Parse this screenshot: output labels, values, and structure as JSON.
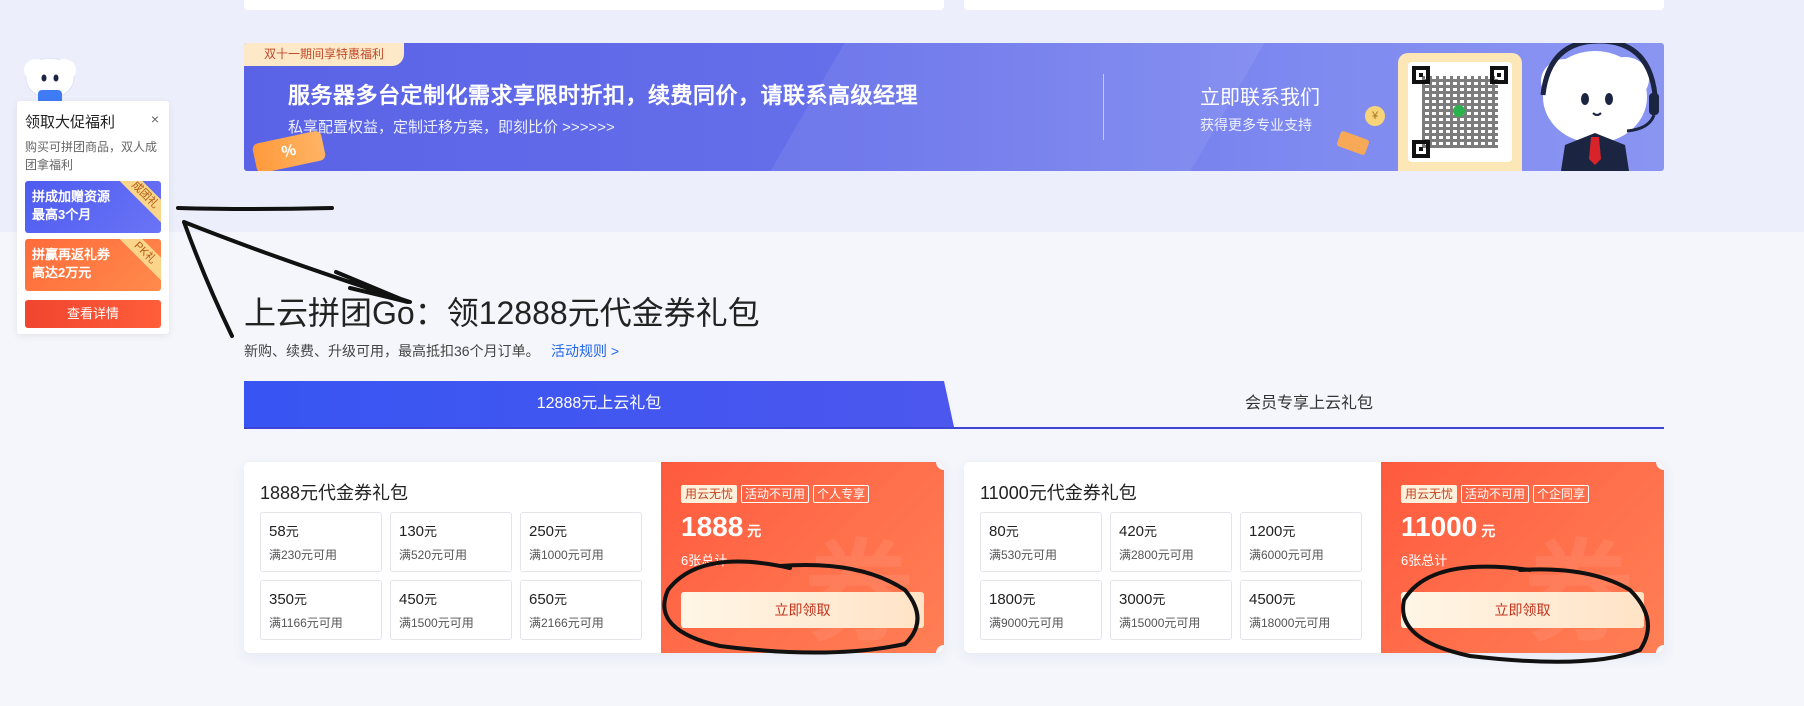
{
  "banner": {
    "tag": "双十一期间享特惠福利",
    "headline": "服务器多台定制化需求享限时折扣，续费同价，请联系高级经理",
    "sub": "私享配置权益，定制迁移方案，即刻比价 >>>>>>",
    "coupon_deco": "%",
    "coin": "¥",
    "contact_title": "立即联系我们",
    "contact_sub": "获得更多专业支持"
  },
  "float_widget": {
    "title": "领取大促福利",
    "close": "×",
    "desc": "购买可拼团商品，双人成团拿福利",
    "promo1": {
      "line1": "拼成加赠资源",
      "line2": "最高3个月",
      "ribbon": "成团礼"
    },
    "promo2": {
      "line1": "拼赢再返礼券",
      "line2": "高达2万元",
      "ribbon": "PK礼"
    },
    "detail_button": "查看详情"
  },
  "section": {
    "title": "上云拼团Go：领12888元代金券礼包",
    "desc": "新购、续费、升级可用，最高抵扣36个月订单。",
    "rules_link": "活动规则 >"
  },
  "tabs": [
    {
      "label": "12888元上云礼包",
      "active": true
    },
    {
      "label": "会员专享上云礼包",
      "active": false
    }
  ],
  "packages": [
    {
      "title": "1888元代金券礼包",
      "vouchers": [
        {
          "amount": "58",
          "unit": "元",
          "cond": "满230元可用"
        },
        {
          "amount": "130",
          "unit": "元",
          "cond": "满520元可用"
        },
        {
          "amount": "250",
          "unit": "元",
          "cond": "满1000元可用"
        },
        {
          "amount": "350",
          "unit": "元",
          "cond": "满1166元可用"
        },
        {
          "amount": "450",
          "unit": "元",
          "cond": "满1500元可用"
        },
        {
          "amount": "650",
          "unit": "元",
          "cond": "满2166元可用"
        }
      ],
      "badges": [
        "用云无忧",
        "活动不可用",
        "个人专享"
      ],
      "total": "1888",
      "total_unit": "元",
      "count": "6张总计",
      "claim": "立即领取",
      "watermark": "券"
    },
    {
      "title": "11000元代金券礼包",
      "vouchers": [
        {
          "amount": "80",
          "unit": "元",
          "cond": "满530元可用"
        },
        {
          "amount": "420",
          "unit": "元",
          "cond": "满2800元可用"
        },
        {
          "amount": "1200",
          "unit": "元",
          "cond": "满6000元可用"
        },
        {
          "amount": "1800",
          "unit": "元",
          "cond": "满9000元可用"
        },
        {
          "amount": "3000",
          "unit": "元",
          "cond": "满15000元可用"
        },
        {
          "amount": "4500",
          "unit": "元",
          "cond": "满18000元可用"
        }
      ],
      "badges": [
        "用云无忧",
        "活动不可用",
        "个企同享"
      ],
      "total": "11000",
      "total_unit": "元",
      "count": "6张总计",
      "claim": "立即领取",
      "watermark": "券"
    }
  ],
  "colors": {
    "accent_blue": "#3755f3",
    "accent_orange": "#ff5a3e",
    "link": "#2266ee",
    "annotation": "#111111"
  }
}
